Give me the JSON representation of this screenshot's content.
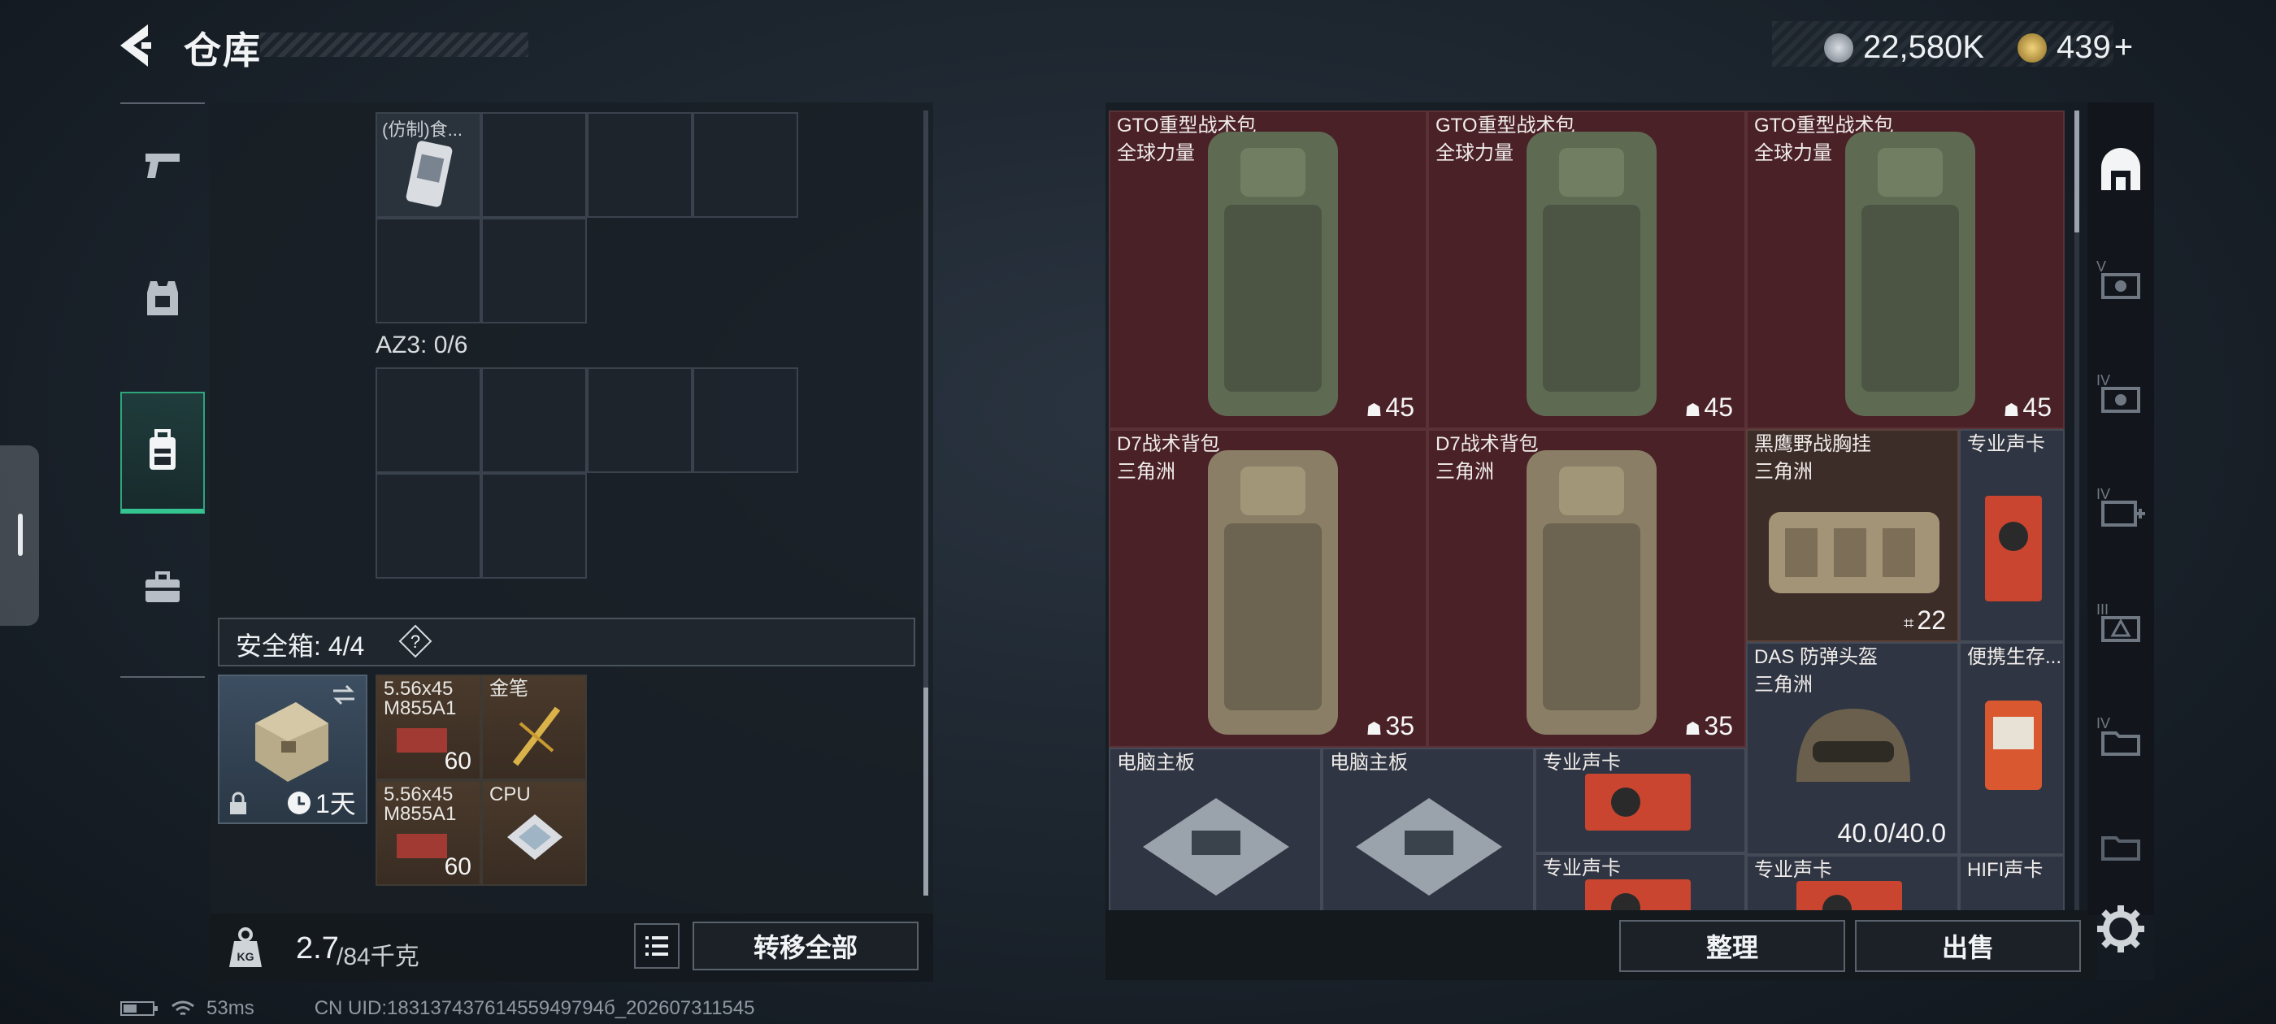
{
  "header": {
    "title": "仓库",
    "currency": [
      {
        "name": "hafcoin",
        "value": "22,580K",
        "icon": "coin-icon"
      },
      {
        "name": "diamond",
        "value": "439",
        "plus": "+",
        "icon": "gem-icon"
      }
    ]
  },
  "left_rail": {
    "items": [
      {
        "name": "weapon",
        "icon": "pistol-icon"
      },
      {
        "name": "armor",
        "icon": "vest-icon"
      },
      {
        "name": "backpack",
        "icon": "backpack-icon",
        "active": true
      },
      {
        "name": "case",
        "icon": "briefcase-icon"
      }
    ]
  },
  "left_panel": {
    "top_item_name": "(仿制)食...",
    "az3_label": "AZ3: 0/6",
    "safebox": {
      "label": "安全箱: 4/4",
      "help": "?",
      "duration": "1天",
      "items": [
        {
          "name": "5.56x45",
          "name2": "M855A1",
          "count": "60"
        },
        {
          "name": "金笔",
          "count": ""
        },
        {
          "name": "5.56x45",
          "name2": "M855A1",
          "count": "60"
        },
        {
          "name": "CPU",
          "count": ""
        }
      ]
    }
  },
  "bottom_left": {
    "weight_icon": "KG",
    "weight_value": "2.7",
    "weight_max": "/84千克",
    "transfer_all": "转移全部"
  },
  "right_grid": {
    "items": [
      {
        "name": "GTO重型战术包",
        "sub": "全球力量",
        "count": "45"
      },
      {
        "name": "GTO重型战术包",
        "sub": "全球力量",
        "count": "45"
      },
      {
        "name": "GTO重型战术包",
        "sub": "全球力量",
        "count": "45"
      },
      {
        "name": "D7战术背包",
        "sub": "三角洲",
        "count": "35"
      },
      {
        "name": "D7战术背包",
        "sub": "三角洲",
        "count": "35"
      },
      {
        "name": "黑鹰野战胸挂",
        "sub": "三角洲",
        "count": "22"
      },
      {
        "name": "专业声卡",
        "sub": "",
        "count": ""
      },
      {
        "name": "DAS 防弹头盔",
        "sub": "三角洲",
        "count": "40.0/40.0"
      },
      {
        "name": "便携生存...",
        "sub": "",
        "count": ""
      },
      {
        "name": "电脑主板",
        "sub": "",
        "count": ""
      },
      {
        "name": "电脑主板",
        "sub": "",
        "count": ""
      },
      {
        "name": "专业声卡",
        "sub": "",
        "count": ""
      },
      {
        "name": "专业声卡",
        "sub": "",
        "count": ""
      },
      {
        "name": "专业声卡",
        "sub": "",
        "count": ""
      },
      {
        "name": "HIFI声卡",
        "sub": "",
        "count": ""
      }
    ]
  },
  "bottom_right": {
    "sort": "整理",
    "sell": "出售"
  },
  "right_rail": {
    "items": [
      {
        "label": "",
        "icon": "hideout-icon"
      },
      {
        "label": "V",
        "icon": "stash-v-icon"
      },
      {
        "label": "IV",
        "icon": "stash-iv-icon"
      },
      {
        "label": "IV",
        "icon": "stash-add-icon"
      },
      {
        "label": "III",
        "icon": "stash-iii-icon"
      },
      {
        "label": "IV",
        "icon": "stash-folder-icon"
      },
      {
        "label": "",
        "icon": "stash-misc-icon"
      }
    ],
    "settings_icon": "gear-icon"
  },
  "status": {
    "ping": "53ms",
    "uid": "CN UID:18313743761455949794б_202607311545"
  }
}
